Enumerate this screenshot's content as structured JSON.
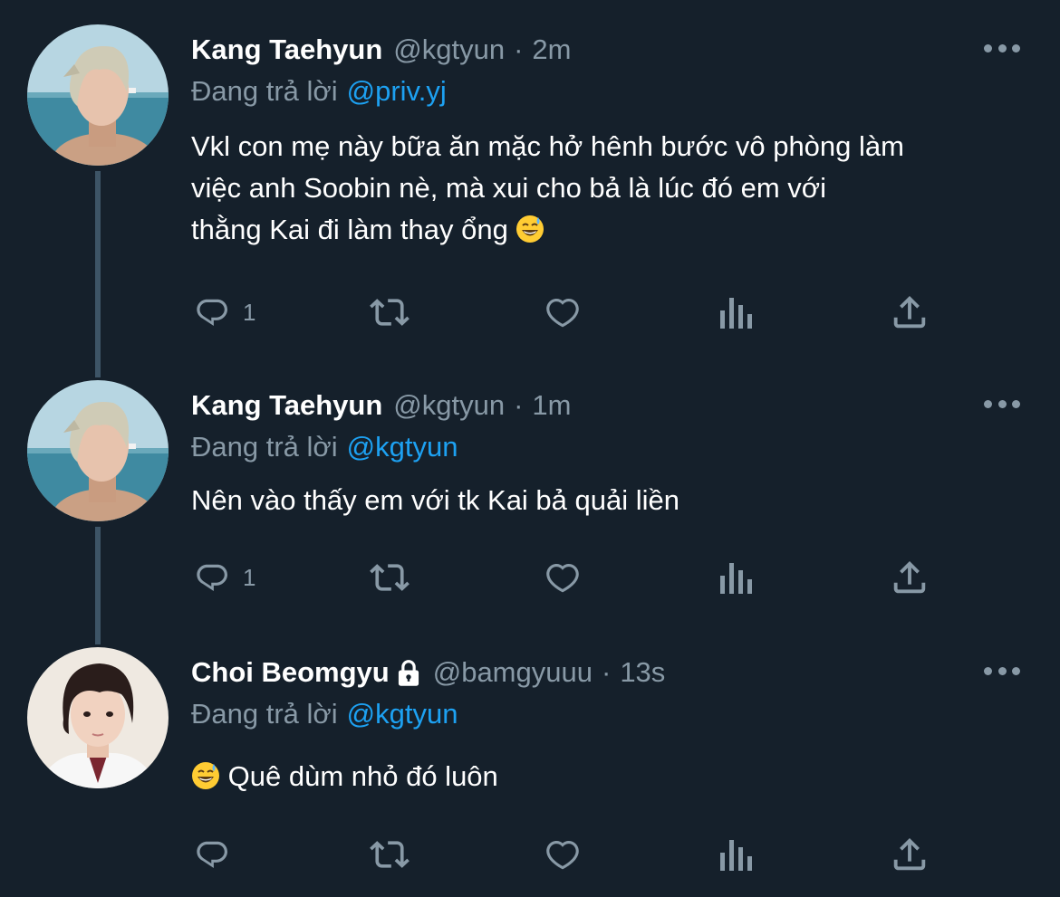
{
  "tweets": [
    {
      "name": "Kang Taehyun",
      "handle": "@kgtyun",
      "separator": "·",
      "time": "2m",
      "reply_prefix": "Đang trả lời",
      "reply_to": "@priv.yj",
      "text_lines": [
        "Vkl con mẹ này bữa ăn mặc hở hênh bước vô phòng làm",
        "việc anh Soobin nè, mà xui cho bả là lúc đó em với",
        "thằng Kai đi làm thay ổng"
      ],
      "emoji": "sweat-smile-emoji",
      "reply_count": "1",
      "locked": false
    },
    {
      "name": "Kang Taehyun",
      "handle": "@kgtyun",
      "separator": "·",
      "time": "1m",
      "reply_prefix": "Đang trả lời",
      "reply_to": "@kgtyun",
      "text_lines": [
        "Nên vào thấy em với tk Kai bả quải liền"
      ],
      "reply_count": "1",
      "locked": false
    },
    {
      "name": "Choi Beomgyu",
      "handle": "@bamgyuuu",
      "separator": "·",
      "time": "13s",
      "reply_prefix": "Đang trả lời",
      "reply_to": "@kgtyun",
      "text_lines": [
        "Quê dùm nhỏ đó luôn"
      ],
      "emoji": "sweat-smile-emoji",
      "reply_count": "",
      "locked": true
    }
  ],
  "icons": {
    "reply": "reply-icon",
    "retweet": "retweet-icon",
    "like": "like-icon",
    "analytics": "analytics-icon",
    "share": "share-icon",
    "more": "more-icon",
    "lock": "lock-icon"
  },
  "colors": {
    "background": "#15202b",
    "text": "#ffffff",
    "muted": "#8899a6",
    "link": "#1da1f2",
    "thread_line": "#3d5466"
  }
}
